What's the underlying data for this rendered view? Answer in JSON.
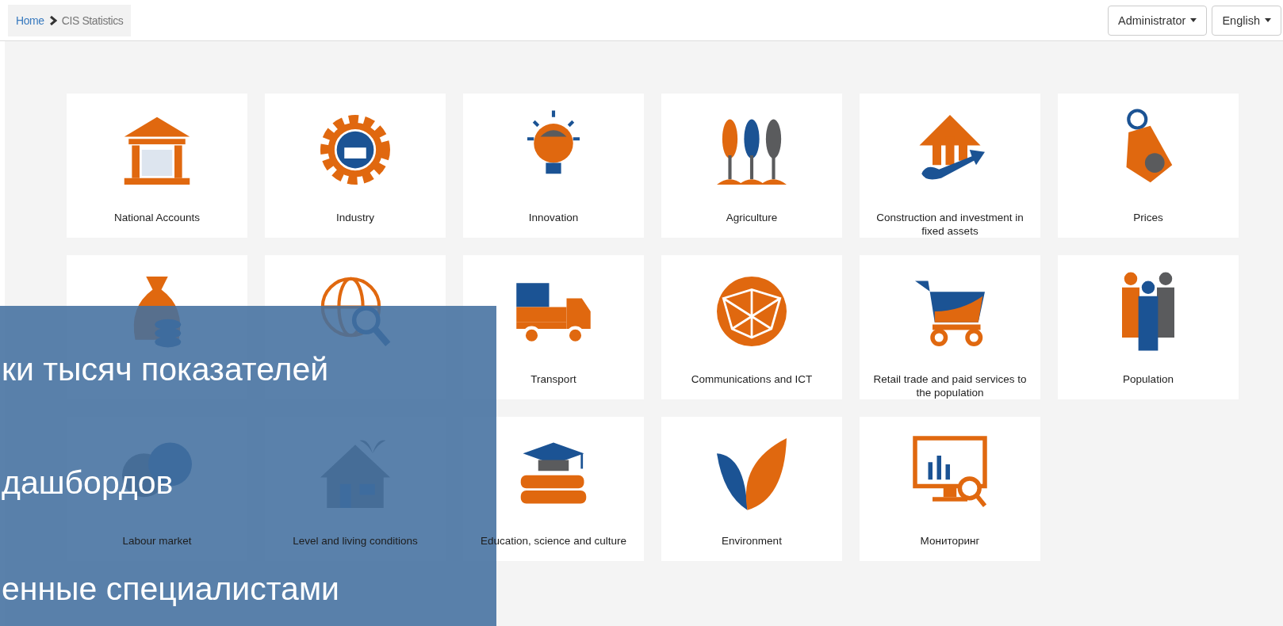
{
  "breadcrumb": [
    {
      "label": "Home",
      "link": true
    },
    {
      "label": "CIS Statistics",
      "link": false
    }
  ],
  "header_buttons": [
    {
      "label": "Administrator"
    },
    {
      "label": "English"
    }
  ],
  "tiles": [
    {
      "kind": "labeled",
      "label": "National Accounts"
    },
    {
      "kind": "labeled",
      "label": "Industry"
    },
    {
      "kind": "labeled",
      "label": "Innovation"
    },
    {
      "kind": "labeled",
      "label": "Agriculture"
    },
    {
      "kind": "labeled",
      "label": "Construction and investment in fixed assets"
    },
    {
      "kind": "labeled",
      "label": "Prices"
    },
    {
      "kind": "unlabeled"
    },
    {
      "kind": "unlabeled"
    },
    {
      "kind": "labeled",
      "label": "Transport"
    },
    {
      "kind": "labeled",
      "label": "Communications and ICT"
    },
    {
      "kind": "labeled",
      "label": "Retail trade and paid services to the population"
    },
    {
      "kind": "labeled",
      "label": "Population"
    },
    {
      "kind": "labeled",
      "label": "Labour market"
    },
    {
      "kind": "labeled",
      "label": "Level and living conditions"
    },
    {
      "kind": "labeled",
      "label": "Education, science and culture"
    },
    {
      "kind": "labeled",
      "label": "Environment"
    },
    {
      "kind": "labeled",
      "label": "Мониторинг"
    }
  ],
  "overlay": {
    "lines": [
      "ки тысяч показателей",
      "дашбордов",
      "енные специалистами"
    ]
  }
}
